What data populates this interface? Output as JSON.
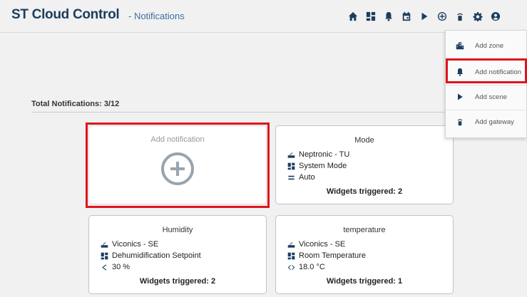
{
  "header": {
    "brand": "ST Cloud Control",
    "subtitle": "- Notifications",
    "icons": [
      "home-icon",
      "dashboard-icon",
      "bell-icon",
      "calendar-icon",
      "play-icon",
      "add-circle-icon",
      "gateway-icon",
      "gear-icon",
      "user-icon"
    ]
  },
  "summary": {
    "total_label": "Total Notifications: 3/12"
  },
  "add_card": {
    "label": "Add notification"
  },
  "cards": [
    {
      "title": "Mode",
      "lines": [
        {
          "icon": "device-icon",
          "text": "Neptronic - TU"
        },
        {
          "icon": "widget-icon",
          "text": "System Mode"
        },
        {
          "icon": "equals-icon",
          "text": "Auto"
        }
      ],
      "triggered": "Widgets triggered: 2"
    },
    {
      "title": "Humidity",
      "lines": [
        {
          "icon": "device-icon",
          "text": "Viconics - SE"
        },
        {
          "icon": "widget-icon",
          "text": "Dehumidification Setpoint"
        },
        {
          "icon": "less-than-icon",
          "text": "30 %"
        }
      ],
      "triggered": "Widgets triggered: 2"
    },
    {
      "title": "temperature",
      "lines": [
        {
          "icon": "device-icon",
          "text": "Viconics - SE"
        },
        {
          "icon": "widget-icon",
          "text": "Room Temperature"
        },
        {
          "icon": "not-equal-icon",
          "text": "18.0 °C"
        }
      ],
      "triggered": "Widgets triggered: 1"
    }
  ],
  "dropdown": {
    "items": [
      {
        "icon": "zone-icon",
        "label": "Add zone"
      },
      {
        "icon": "bell-icon",
        "label": "Add notification"
      },
      {
        "icon": "play-icon",
        "label": "Add scene"
      },
      {
        "icon": "gateway-icon",
        "label": "Add gateway"
      }
    ]
  },
  "colors": {
    "brand": "#1b3d5e",
    "accent": "#3d6fa0",
    "highlight": "#e0141b",
    "card_border": "#b7c4d4"
  }
}
